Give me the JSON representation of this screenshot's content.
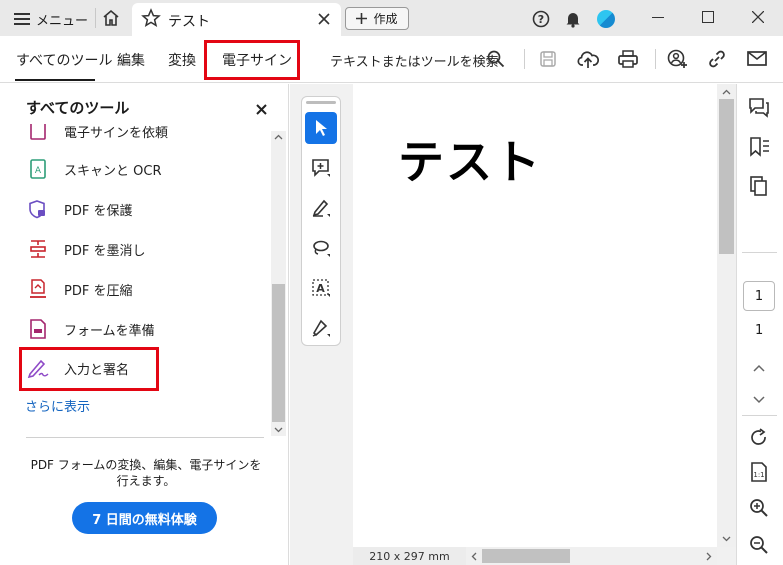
{
  "titlebar": {
    "menu_label": "メニュー",
    "doc_tab_title": "テスト",
    "create_label": "作成"
  },
  "toolbar": {
    "tabs": [
      "すべてのツール",
      "編集",
      "変換",
      "電子サイン"
    ],
    "search_label": "テキストまたはツールを検索"
  },
  "leftpane": {
    "title": "すべてのツール",
    "items": [
      {
        "label": "電子サインを依頼",
        "icon": "request-signature-icon"
      },
      {
        "label": "スキャンと OCR",
        "icon": "scan-ocr-icon"
      },
      {
        "label": "PDF を保護",
        "icon": "protect-pdf-icon"
      },
      {
        "label": "PDF を墨消し",
        "icon": "redact-pdf-icon"
      },
      {
        "label": "PDF を圧縮",
        "icon": "compress-pdf-icon"
      },
      {
        "label": "フォームを準備",
        "icon": "prepare-form-icon"
      },
      {
        "label": "入力と署名",
        "icon": "fill-sign-icon"
      }
    ],
    "show_more": "さらに表示",
    "promo_text": "PDF フォームの変換、編集、電子サインを行えます。",
    "trial_button": "7 日間の無料体験"
  },
  "document": {
    "heading": "テスト",
    "page_size": "210 x 297 mm"
  },
  "rightrail": {
    "page_input": "1",
    "page_total": "1"
  },
  "colors": {
    "accent": "#1473e6",
    "highlight": "#e30613",
    "tool_icon": "#a4266e"
  }
}
